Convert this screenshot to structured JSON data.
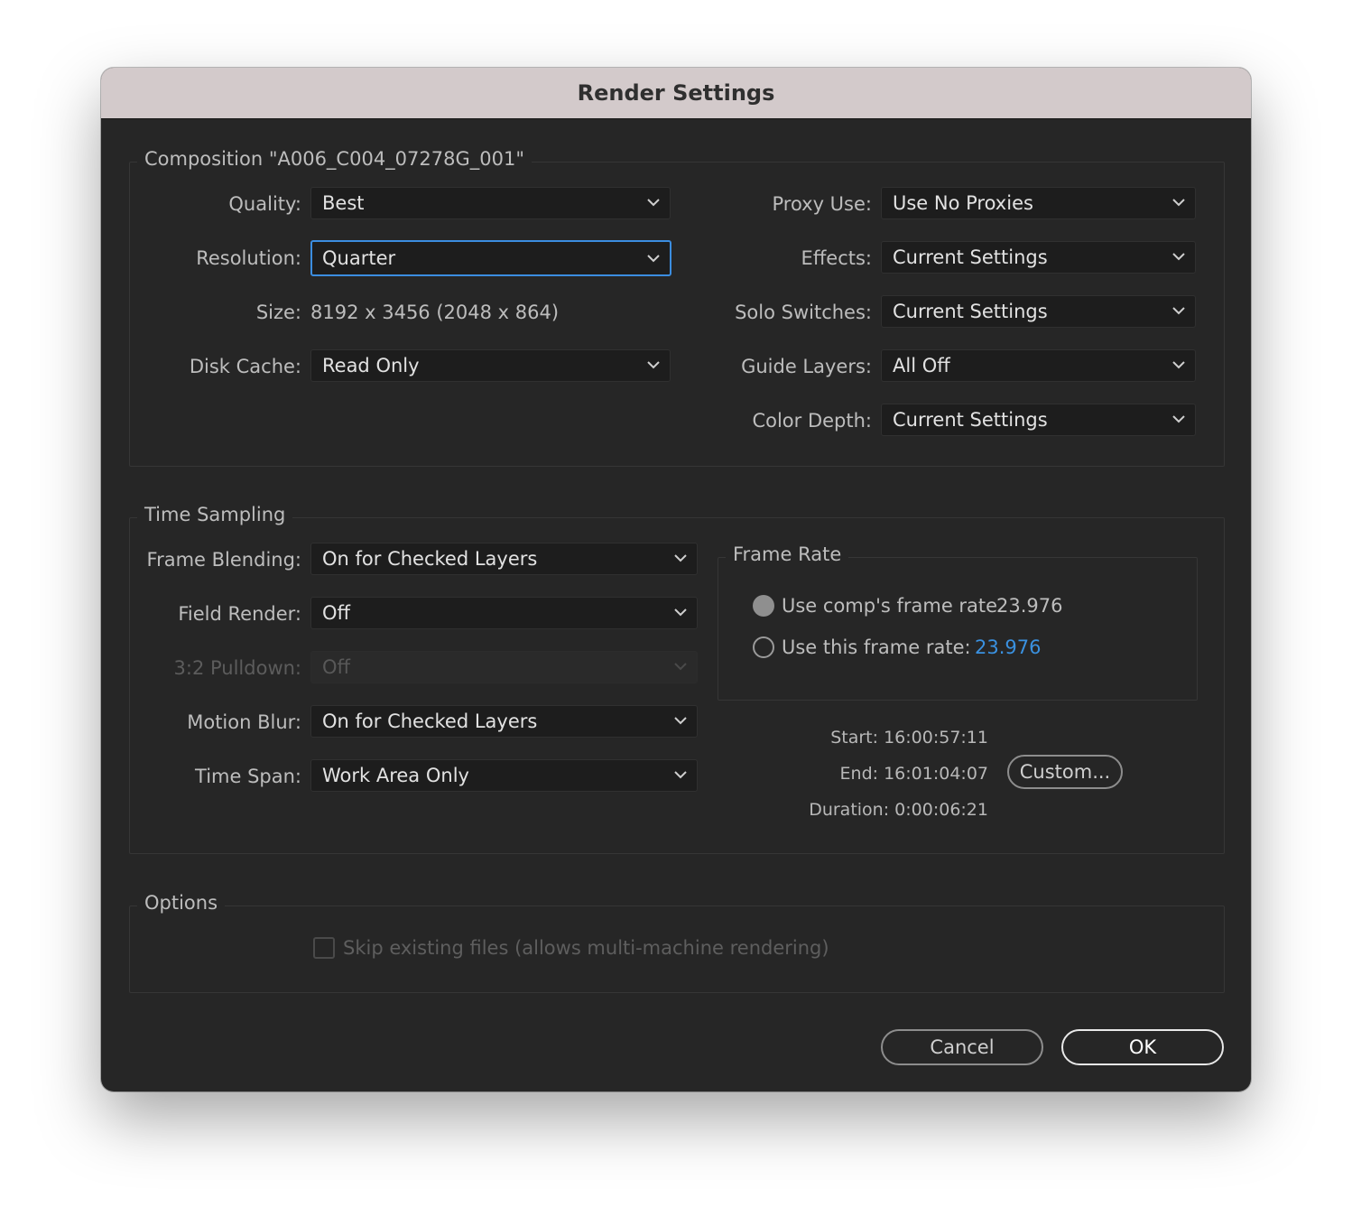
{
  "window": {
    "title": "Render Settings"
  },
  "composition": {
    "legend": "Composition \"A006_C004_07278G_001\"",
    "quality": {
      "label": "Quality:",
      "value": "Best"
    },
    "resolution": {
      "label": "Resolution:",
      "value": "Quarter"
    },
    "size": {
      "label": "Size:",
      "value": "8192 x 3456 (2048 x 864)"
    },
    "disk_cache": {
      "label": "Disk Cache:",
      "value": "Read Only"
    },
    "proxy_use": {
      "label": "Proxy Use:",
      "value": "Use No Proxies"
    },
    "effects": {
      "label": "Effects:",
      "value": "Current Settings"
    },
    "solo_switches": {
      "label": "Solo Switches:",
      "value": "Current Settings"
    },
    "guide_layers": {
      "label": "Guide Layers:",
      "value": "All Off"
    },
    "color_depth": {
      "label": "Color Depth:",
      "value": "Current Settings"
    }
  },
  "time_sampling": {
    "legend": "Time Sampling",
    "frame_blending": {
      "label": "Frame Blending:",
      "value": "On for Checked Layers"
    },
    "field_render": {
      "label": "Field Render:",
      "value": "Off"
    },
    "pulldown": {
      "label": "3:2 Pulldown:",
      "value": "Off",
      "disabled": true
    },
    "motion_blur": {
      "label": "Motion Blur:",
      "value": "On for Checked Layers"
    },
    "time_span": {
      "label": "Time Span:",
      "value": "Work Area Only"
    },
    "frame_rate": {
      "legend": "Frame Rate",
      "use_comp": {
        "label": "Use comp's frame rate",
        "value": "23.976",
        "selected": true
      },
      "use_this": {
        "label": "Use this frame rate:",
        "value": "23.976",
        "selected": false
      }
    },
    "start": "Start: 16:00:57:11",
    "end": "End: 16:01:04:07",
    "duration": "Duration: 0:00:06:21",
    "custom_label": "Custom..."
  },
  "options": {
    "legend": "Options",
    "skip_existing": {
      "label": "Skip existing files (allows multi-machine rendering)",
      "checked": false
    }
  },
  "buttons": {
    "cancel": "Cancel",
    "ok": "OK"
  },
  "colors": {
    "accent": "#3b8de0",
    "link_value": "#3a91e0",
    "title_bar": "#d3cacb",
    "panel": "#262626"
  }
}
